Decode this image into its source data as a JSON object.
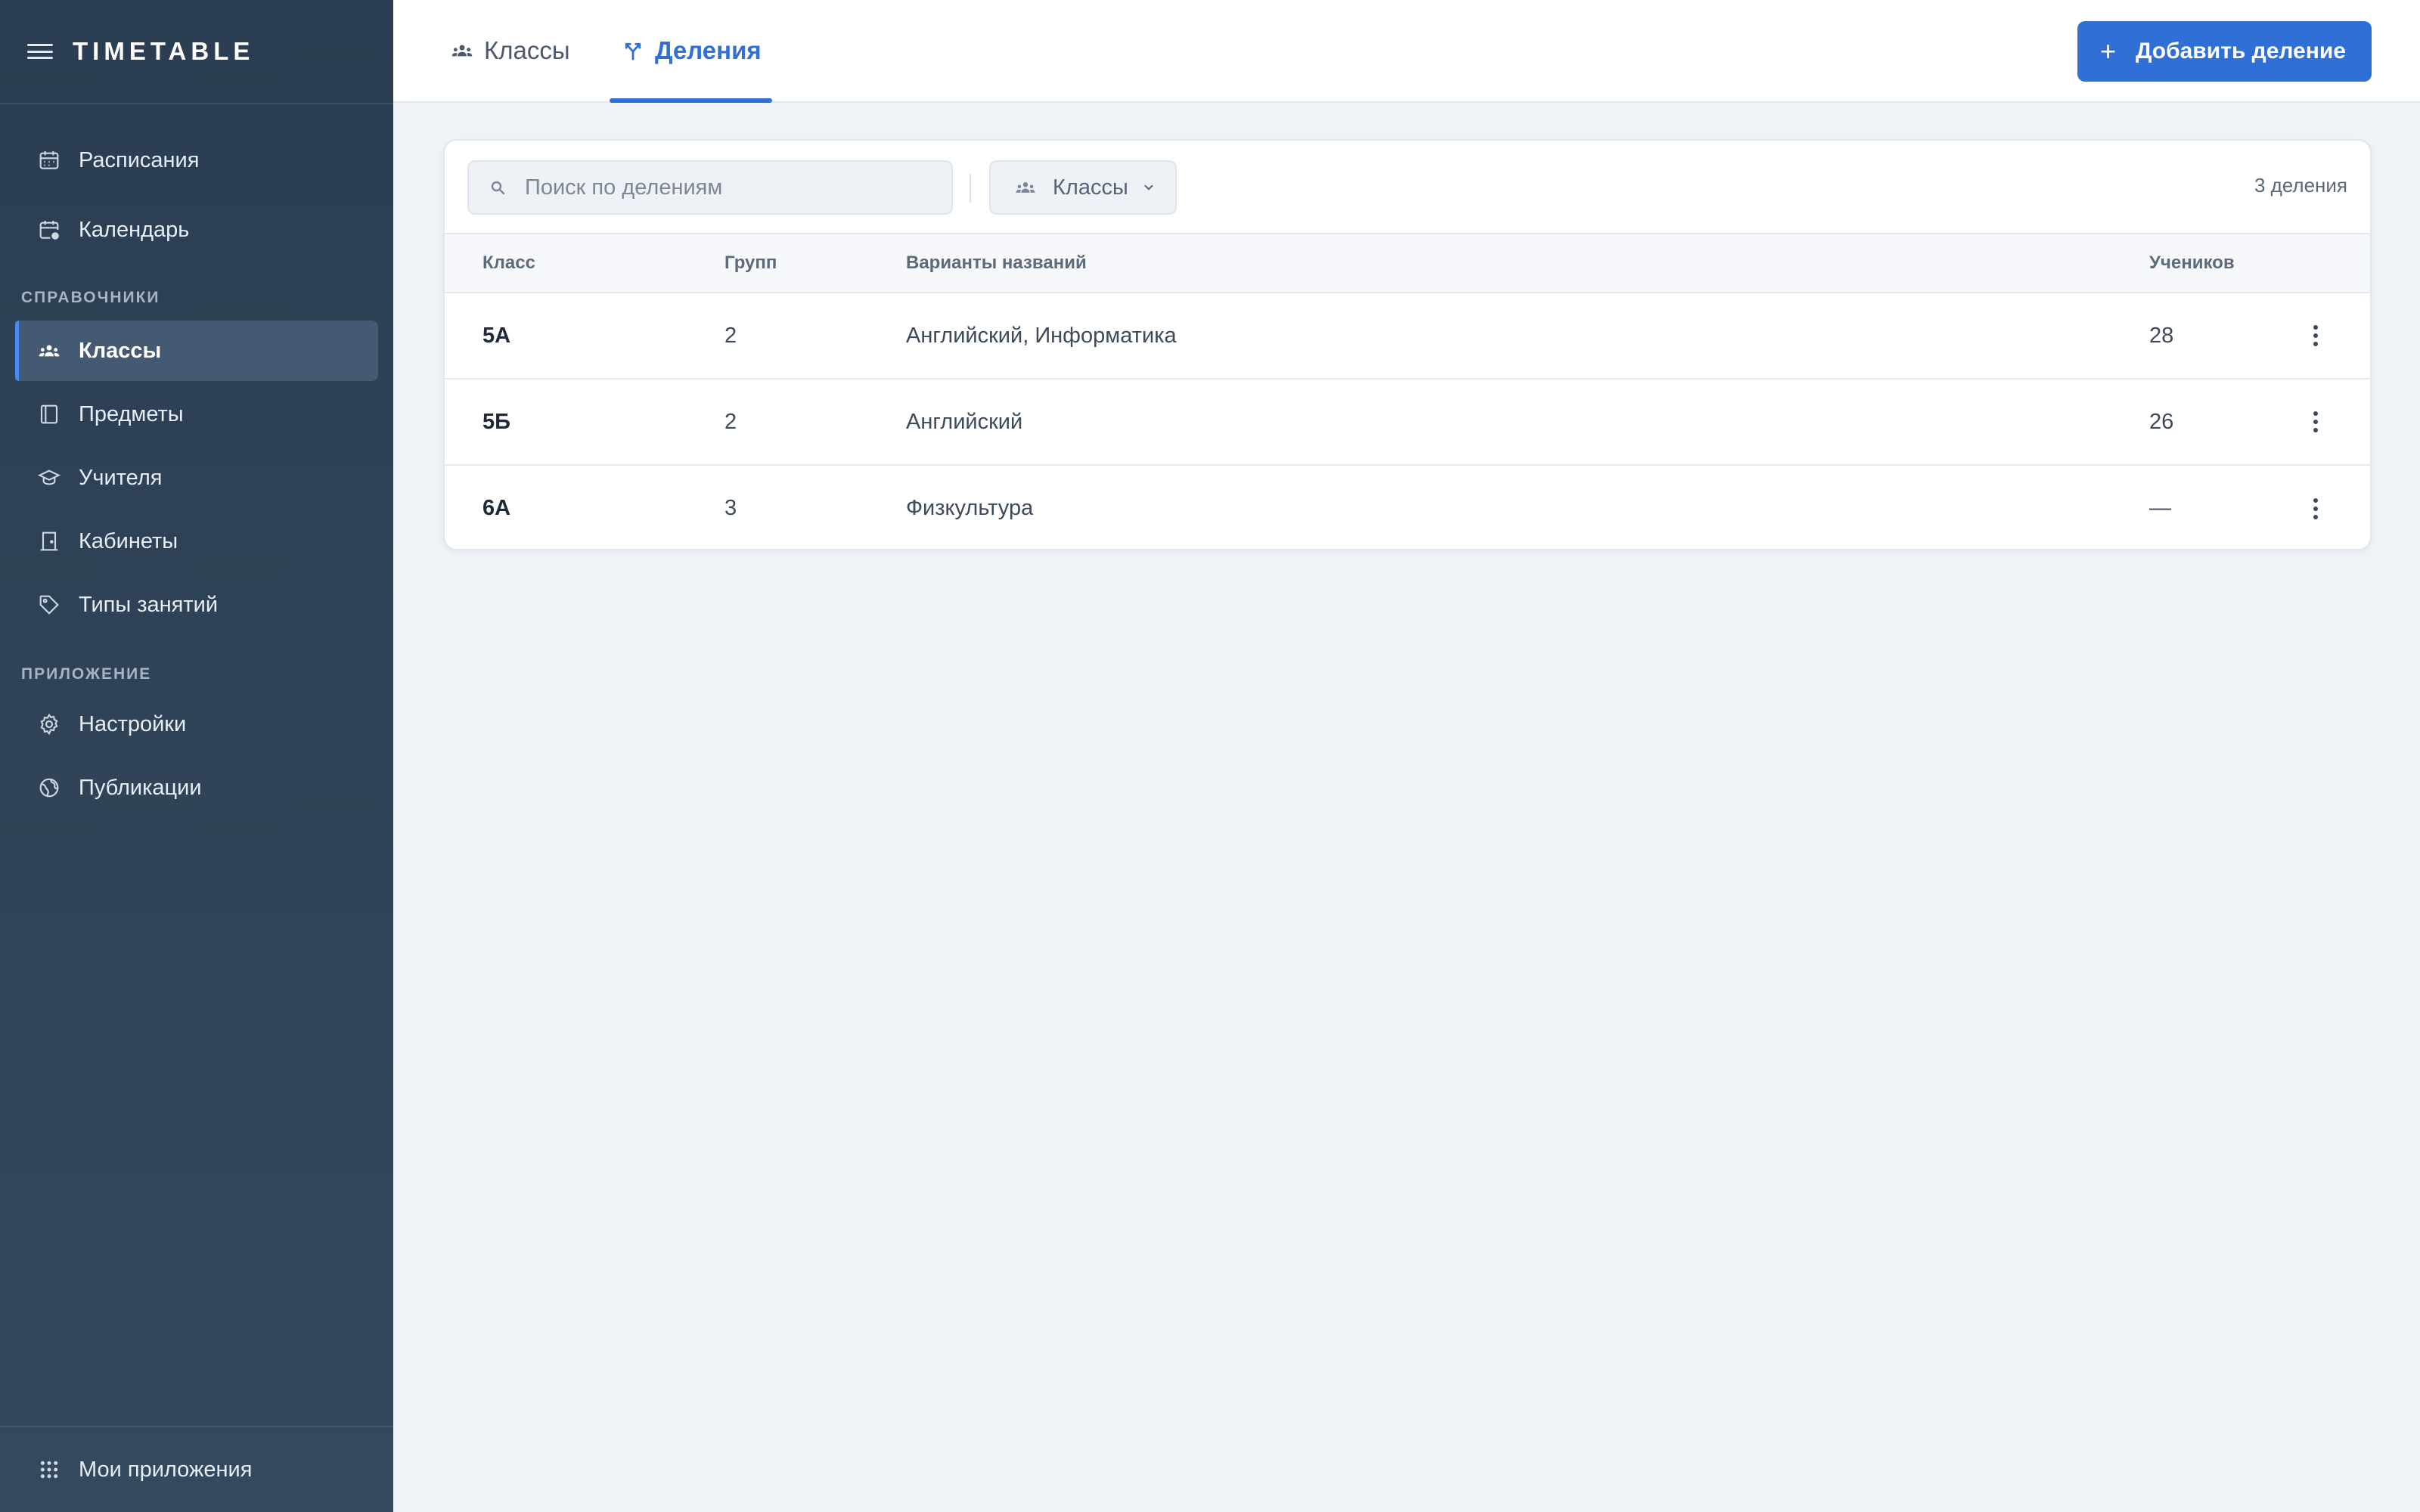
{
  "app": {
    "title": "TIMETABLE"
  },
  "sidebar": {
    "items_top": [
      {
        "label": "Расписания",
        "icon": "calendar-icon"
      },
      {
        "label": "Календарь",
        "icon": "calendar-clock-icon"
      }
    ],
    "section_references": "СПРАВОЧНИКИ",
    "items_references": [
      {
        "label": "Классы",
        "icon": "users-icon",
        "active": true
      },
      {
        "label": "Предметы",
        "icon": "book-icon"
      },
      {
        "label": "Учителя",
        "icon": "graduation-cap-icon"
      },
      {
        "label": "Кабинеты",
        "icon": "door-icon"
      },
      {
        "label": "Типы занятий",
        "icon": "tag-icon"
      }
    ],
    "section_app": "ПРИЛОЖЕНИЕ",
    "items_app": [
      {
        "label": "Настройки",
        "icon": "gear-icon"
      },
      {
        "label": "Публикации",
        "icon": "globe-icon"
      }
    ],
    "footer": {
      "label": "Мои приложения",
      "icon": "grid-icon"
    }
  },
  "tabs": [
    {
      "label": "Классы",
      "icon": "users-icon",
      "active": false
    },
    {
      "label": "Деления",
      "icon": "split-icon",
      "active": true
    }
  ],
  "actions": {
    "add_label": "Добавить деление",
    "add_icon": "plus-icon"
  },
  "toolbar": {
    "search_placeholder": "Поиск по делениям",
    "search_value": "",
    "filter_label": "Классы",
    "count_text": "3 деления"
  },
  "table": {
    "headers": {
      "class": "Класс",
      "groups": "Групп",
      "names": "Варианты названий",
      "students": "Учеников"
    },
    "rows": [
      {
        "class": "5А",
        "groups": "2",
        "names": "Английский, Информатика",
        "students": "28"
      },
      {
        "class": "5Б",
        "groups": "2",
        "names": "Английский",
        "students": "26"
      },
      {
        "class": "6А",
        "groups": "3",
        "names": "Физкультура",
        "students": "—"
      }
    ]
  },
  "colors": {
    "sidebar_bg": "#2b3d52",
    "accent": "#2f6fd6",
    "page_bg": "#eff3f8",
    "active_item_bg": "#435a72"
  }
}
